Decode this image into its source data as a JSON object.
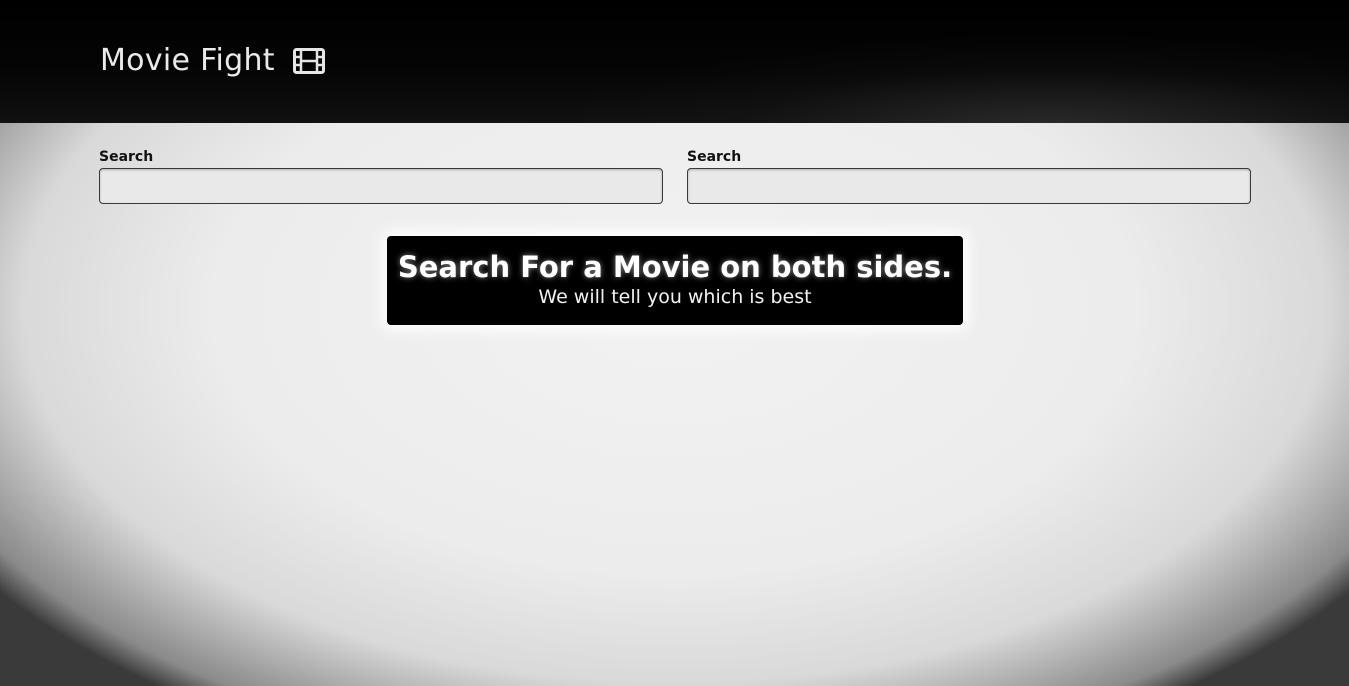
{
  "header": {
    "title": "Movie Fight",
    "icon": "film-icon"
  },
  "search_left": {
    "label": "Search",
    "value": "",
    "placeholder": ""
  },
  "search_right": {
    "label": "Search",
    "value": "",
    "placeholder": ""
  },
  "notice": {
    "title": "Search For a Movie on both sides.",
    "subtitle": "We will tell you which is best"
  },
  "colors": {
    "header_bg": "#000000",
    "page_bg": "#ececec",
    "notice_bg": "#000000",
    "notice_text": "#ffffff"
  }
}
